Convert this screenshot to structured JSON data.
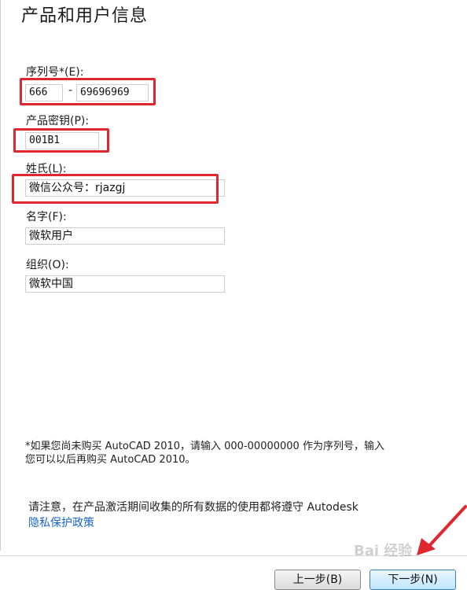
{
  "page_title": "产品和用户信息",
  "serial": {
    "label": "序列号*(E):",
    "part1": "666",
    "separator": "-",
    "part2": "69696969"
  },
  "product_key": {
    "label": "产品密钥(P):",
    "value": "001B1"
  },
  "last_name": {
    "label": "姓氏(L):",
    "value": "微信公众号：rjazgj"
  },
  "first_name": {
    "label": "名字(F):",
    "value": "微软用户"
  },
  "organization": {
    "label": "组织(O):",
    "value": "微软中国"
  },
  "notes": {
    "line1": "*如果您尚未购买 AutoCAD 2010，请输入 000-00000000 作为序列号，输入",
    "line2": "您可以以后再购买 AutoCAD 2010。",
    "privacy_text": "请注意，在产品激活期间收集的所有数据的使用都将遵守 Autodesk",
    "privacy_link": "隐私保护政策"
  },
  "buttons": {
    "back": "上一步(B)",
    "next": "下一步(N)"
  },
  "annotation_color": "#e0262f",
  "watermark": "Bai 经验"
}
